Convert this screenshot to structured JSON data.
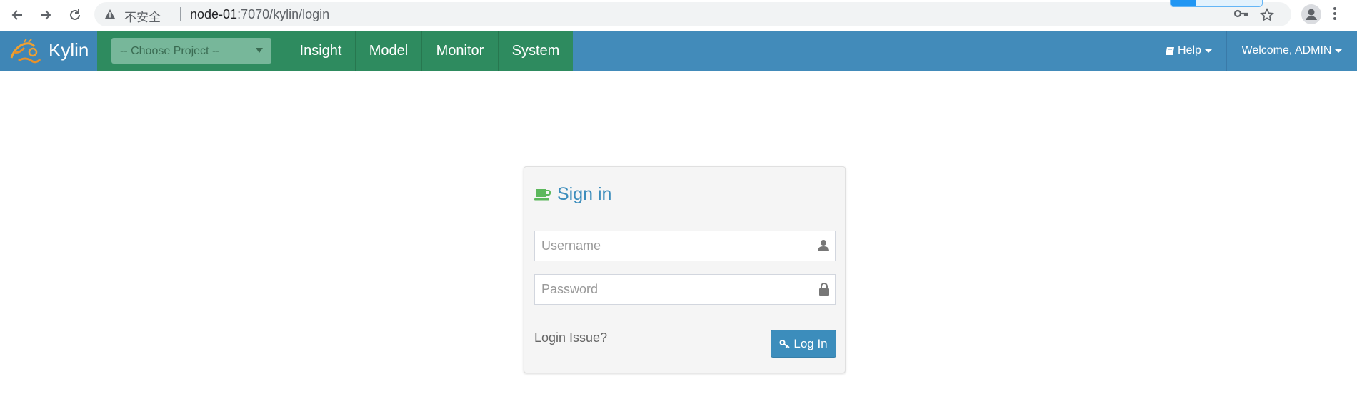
{
  "browser": {
    "security_label": "不安全",
    "url_host": "node-01",
    "url_rest": ":7070/kylin/login"
  },
  "navbar": {
    "brand": "Kylin",
    "project_select": "-- Choose Project --",
    "items": [
      "Insight",
      "Model",
      "Monitor",
      "System"
    ],
    "help": "Help",
    "welcome": "Welcome, ADMIN"
  },
  "login": {
    "title": "Sign in",
    "username_placeholder": "Username",
    "password_placeholder": "Password",
    "issue_link": "Login Issue?",
    "button": "Log In"
  },
  "colors": {
    "navbar": "#428bba",
    "nav_green": "#2e8b5f",
    "accent": "#3c8dbc",
    "coffee_icon": "#5cb85c"
  }
}
